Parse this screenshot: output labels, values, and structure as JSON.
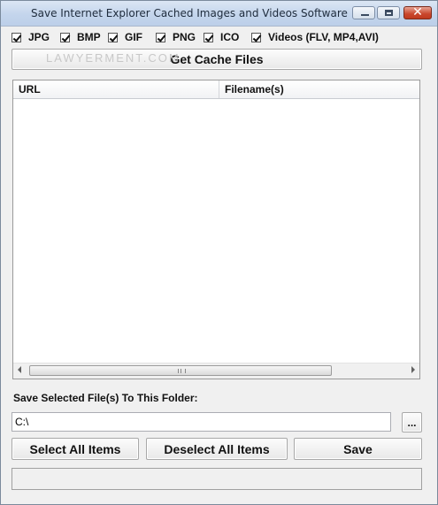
{
  "window": {
    "title": "Save Internet Explorer Cached Images and Videos Software"
  },
  "filters": [
    {
      "label": "JPG",
      "checked": true
    },
    {
      "label": "BMP",
      "checked": true
    },
    {
      "label": "GIF",
      "checked": true
    },
    {
      "label": "PNG",
      "checked": true
    },
    {
      "label": "ICO",
      "checked": true
    },
    {
      "label": "Videos (FLV, MP4,AVI)",
      "checked": true
    }
  ],
  "actions": {
    "get_cache_label": "Get Cache Files",
    "watermark": "LAWYERMENT.COM",
    "select_all_label": "Select All Items",
    "deselect_all_label": "Deselect All Items",
    "save_label": "Save",
    "browse_label": "..."
  },
  "list": {
    "columns": [
      "URL",
      "Filename(s)"
    ]
  },
  "folder": {
    "label": "Save Selected File(s) To This Folder:",
    "value": "C:\\"
  },
  "status": {
    "text": ""
  }
}
